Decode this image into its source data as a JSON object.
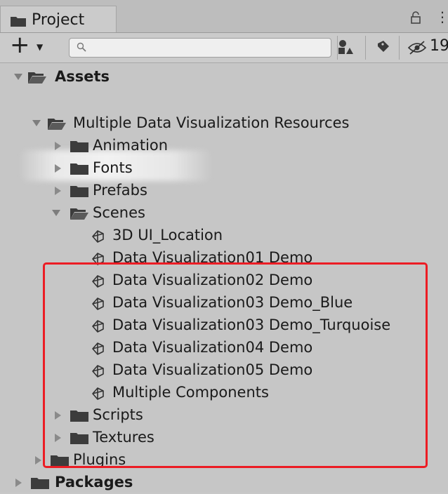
{
  "tab": {
    "title": "Project"
  },
  "toolbar": {
    "add_symbol": "+",
    "search_value": "",
    "hidden_count": "19"
  },
  "tree": {
    "assets": "Assets",
    "mdvr": "Multiple Data Visualization Resources",
    "animation": "Animation",
    "fonts": "Fonts",
    "prefabs": "Prefabs",
    "scenes": "Scenes",
    "scene_items": [
      "3D UI_Location",
      "Data Visualization01 Demo",
      "Data Visualization02 Demo",
      "Data Visualization03 Demo_Blue",
      "Data Visualization03 Demo_Turquoise",
      "Data Visualization04 Demo",
      "Data Visualization05 Demo",
      "Multiple Components"
    ],
    "scripts": "Scripts",
    "textures": "Textures",
    "plugins": "Plugins",
    "packages": "Packages"
  },
  "colors": {
    "highlight": "#ec1c24",
    "folder": "#3c3c3c",
    "panel": "#c8c8c8"
  },
  "icons": {
    "folder": "folder-icon",
    "open_folder": "open-folder-icon",
    "scene": "unity-scene-icon",
    "lock": "lock-icon",
    "search": "search-icon"
  }
}
